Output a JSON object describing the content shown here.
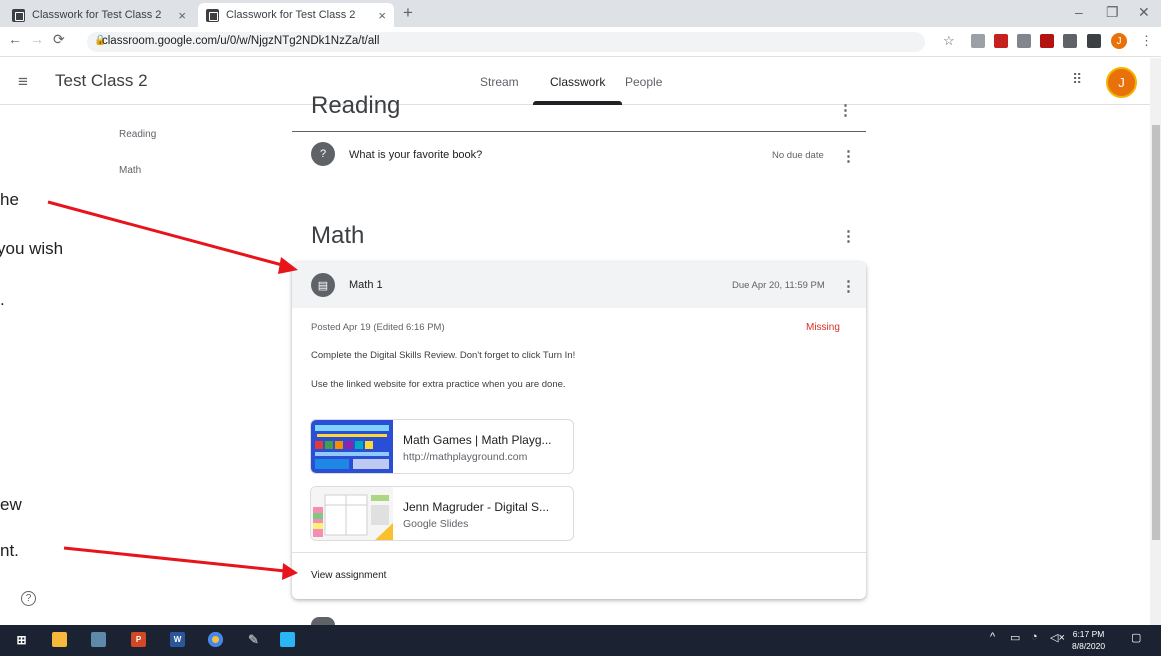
{
  "browser": {
    "tabs": [
      {
        "title": "Classwork for Test Class 2",
        "active": false
      },
      {
        "title": "Classwork for Test Class 2",
        "active": true
      }
    ],
    "new_tab_icon": "+",
    "url": "classroom.google.com/u/0/w/NjgzNTg2NDk1NzZa/t/all",
    "profile_initial": "J"
  },
  "header": {
    "class_name": "Test Class 2",
    "tabs": [
      "Stream",
      "Classwork",
      "People"
    ],
    "active_tab": "Classwork",
    "avatar_initial": "J"
  },
  "sidebar": {
    "topics": [
      "Reading",
      "Math"
    ]
  },
  "sections": {
    "reading": {
      "title": "Reading",
      "item": {
        "title": "What is your favorite book?",
        "due": "No due date"
      }
    },
    "math": {
      "title": "Math",
      "item": {
        "title": "Math 1",
        "due": "Due Apr 20, 11:59 PM"
      },
      "posted": "Posted Apr 19 (Edited 6:16 PM)",
      "status": "Missing",
      "instructions": [
        "Complete the Digital Skills Review. Don't forget to click Turn In!",
        "Use the linked website for extra practice when you are done."
      ],
      "attachments": [
        {
          "title": "Math Games | Math Playg...",
          "subtitle": "http://mathplayground.com"
        },
        {
          "title": "Jenn Magruder - Digital S...",
          "subtitle": "Google Slides"
        }
      ],
      "view_link": "View assignment"
    }
  },
  "annotations": {
    "top": [
      "he",
      "you wish",
      "."
    ],
    "bottom": [
      "ew",
      "nt."
    ]
  },
  "taskbar": {
    "time": "6:17 PM",
    "date": "8/8/2020"
  },
  "colors": {
    "missing": "#d93025",
    "arrow": "#e8141c",
    "taskbar": "#1b2332",
    "avatar": "#e8710a"
  }
}
